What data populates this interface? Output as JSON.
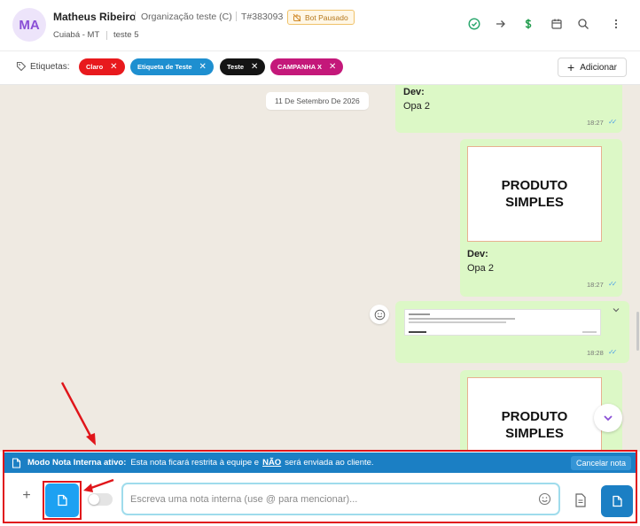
{
  "header": {
    "avatar_initials": "MA",
    "contact_name": "Matheus Ribeiro",
    "organization": "Organização teste (C)",
    "ticket": "T#383093",
    "bot_status": "Bot Pausado",
    "location": "Cuiabá - MT",
    "team": "teste 5",
    "icons": [
      "check-circle-icon",
      "arrow-right-icon",
      "dollar-icon",
      "calendar-icon",
      "search-icon",
      "more-vertical-icon"
    ]
  },
  "tags": {
    "label": "Etiquetas:",
    "items": [
      {
        "label": "Claro",
        "color": "#e8191d"
      },
      {
        "label": "Etiqueta de Teste",
        "color": "#1e8fd0"
      },
      {
        "label": "Teste",
        "color": "#141414"
      },
      {
        "label": "CAMPANHA X",
        "color": "#c4187a"
      }
    ],
    "add_label": "Adicionar"
  },
  "chat": {
    "date_chip": "11 De Setembro De 2026",
    "messages": [
      {
        "author": "Dev:",
        "text": "Opa 2",
        "time": "18:27"
      },
      {
        "image_text_line1": "PRODUTO",
        "image_text_line2": "SIMPLES",
        "author": "Dev:",
        "text": "Opa 2",
        "time": "18:27"
      },
      {
        "type": "document",
        "time": "18:28"
      },
      {
        "image_text_line1": "PRODUTO",
        "image_text_line2": "SIMPLES"
      }
    ]
  },
  "composer": {
    "banner_bold": "Modo Nota Interna ativo:",
    "banner_text_1": "Esta nota ficará restrita à equipe e",
    "banner_no": "NÃO",
    "banner_text_2": "será enviada ao cliente.",
    "cancel_label": "Cancelar nota",
    "plus_label": "+",
    "input_placeholder": "Escreva uma nota interna (use @ para mencionar)...",
    "input_value": ""
  },
  "colors": {
    "accent": "#1b7fc4",
    "bubble": "#dcf8c6",
    "chat_bg": "#efeae2",
    "highlight": "#e0151a"
  }
}
